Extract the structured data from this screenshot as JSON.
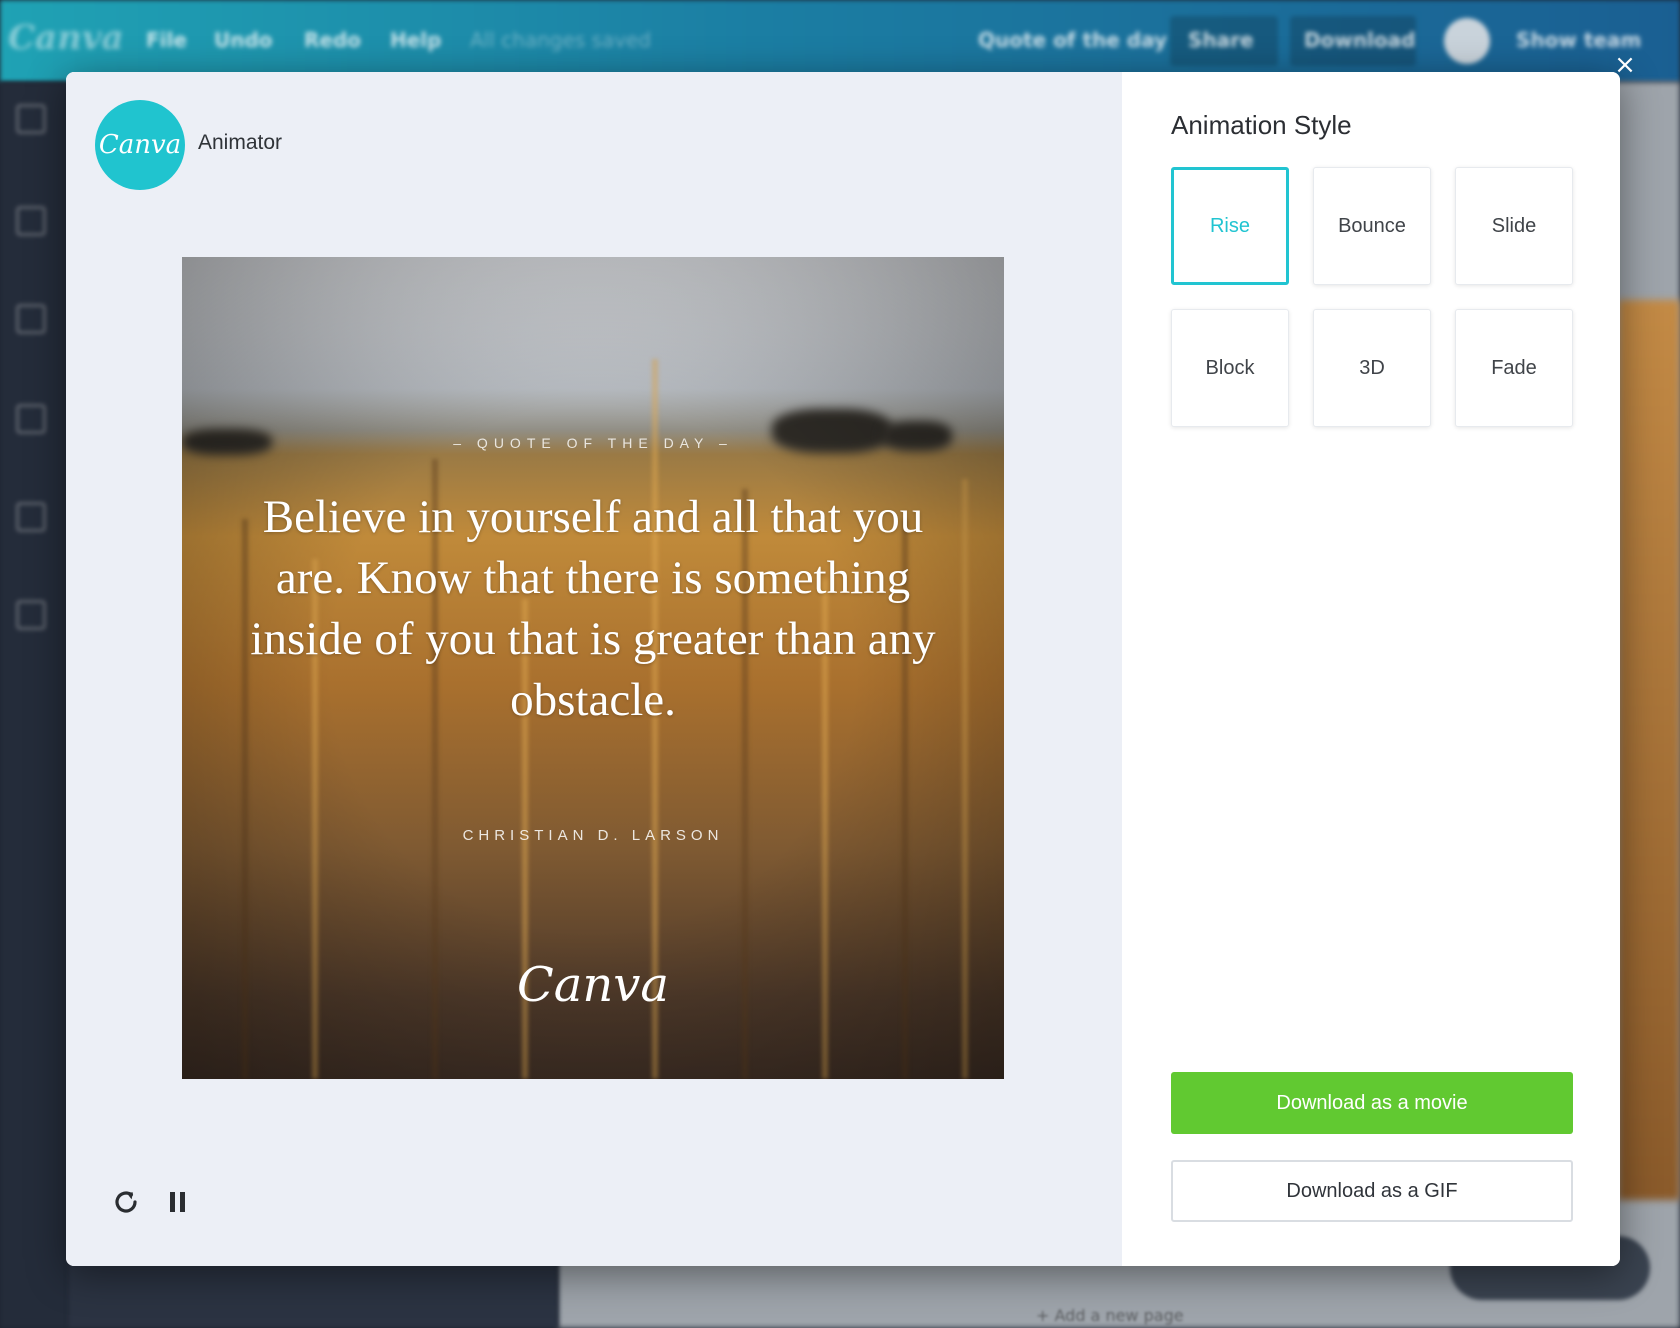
{
  "background_app": {
    "logo": "Canva",
    "menu": [
      "File",
      "Undo",
      "Redo",
      "Help"
    ],
    "save_status": "All changes saved",
    "document_title": "Quote of the day",
    "share_label": "Share",
    "download_label": "Download",
    "upgrade_label": "Show team",
    "add_page_label": "+ Add a new page"
  },
  "modal": {
    "close_glyph": "×",
    "brand": {
      "logo_text": "Canva",
      "title": "Animator"
    },
    "artwork": {
      "kicker": "– QUOTE OF THE DAY –",
      "quote": "Believe in yourself and all that you are. Know that there is something inside of you that is greater than any obstacle.",
      "author": "CHRISTIAN D. LARSON",
      "logo": "Canva"
    },
    "playback": {
      "replay_icon": "replay-icon",
      "pause_icon": "pause-icon"
    },
    "options": {
      "title": "Animation Style",
      "styles": [
        "Rise",
        "Bounce",
        "Slide",
        "Block",
        "3D",
        "Fade"
      ],
      "selected_style": "Rise",
      "download_movie_label": "Download as a movie",
      "download_gif_label": "Download as a GIF"
    }
  },
  "colors": {
    "accent": "#21c4d1",
    "primary_button": "#61c931",
    "preview_background": "#eceff6"
  }
}
